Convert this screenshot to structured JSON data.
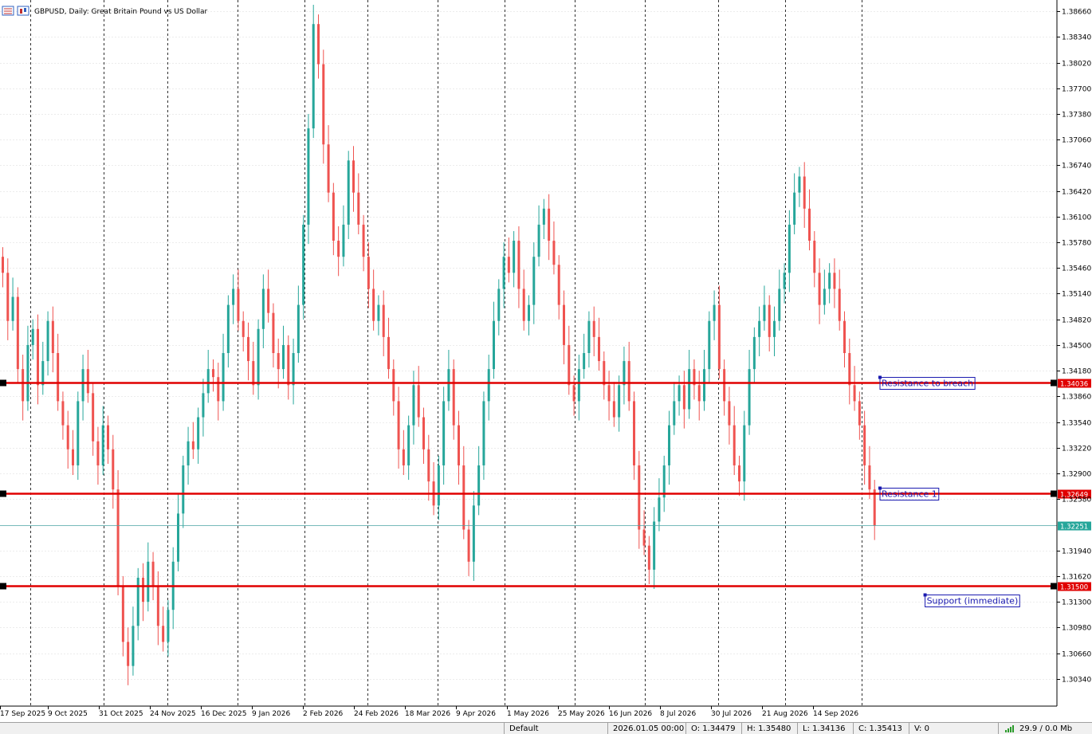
{
  "header": {
    "symbol_line": "GBPUSD, Daily:  Great Britain Pound vs US Dollar"
  },
  "colors": {
    "bull": "#26a69a",
    "bear": "#ef5350",
    "level_line": "#e00000",
    "label_text": "#1a1ab0",
    "price_line": "#4aa3a3"
  },
  "chart_data": {
    "type": "candlestick",
    "ylim": [
      1.3,
      1.388
    ],
    "y_ticks": [
      "1.38660",
      "1.38340",
      "1.38020",
      "1.37700",
      "1.37380",
      "1.37060",
      "1.36740",
      "1.36420",
      "1.36100",
      "1.35780",
      "1.35460",
      "1.35140",
      "1.34820",
      "1.34500",
      "1.34180",
      "1.33860",
      "1.33540",
      "1.33220",
      "1.32900",
      "1.32580",
      "1.31940",
      "1.31620",
      "1.31300",
      "1.30980",
      "1.30660",
      "1.30340"
    ],
    "x_ticks": [
      "17 Sep 2025",
      "9 Oct 2025",
      "31 Oct 2025",
      "24 Nov 2025",
      "16 Dec 2025",
      "9 Jan 2026",
      "2 Feb 2026",
      "24 Feb 2026",
      "18 Mar 2026",
      "9 Apr 2026",
      "1 May 2026",
      "25 May 2026",
      "16 Jun 2026",
      "8 Jul 2026",
      "30 Jul 2026",
      "21 Aug 2026",
      "14 Sep 2026"
    ],
    "closes": [
      1.354,
      1.348,
      1.351,
      1.342,
      1.338,
      1.345,
      1.347,
      1.34,
      1.343,
      1.348,
      1.344,
      1.338,
      1.335,
      1.332,
      1.33,
      1.338,
      1.342,
      1.339,
      1.333,
      1.33,
      1.335,
      1.332,
      1.327,
      1.315,
      1.308,
      1.305,
      1.31,
      1.316,
      1.313,
      1.318,
      1.315,
      1.31,
      1.308,
      1.312,
      1.318,
      1.324,
      1.33,
      1.333,
      1.332,
      1.336,
      1.339,
      1.342,
      1.341,
      1.338,
      1.344,
      1.35,
      1.352,
      1.348,
      1.346,
      1.343,
      1.34,
      1.347,
      1.352,
      1.349,
      1.344,
      1.342,
      1.345,
      1.34,
      1.344,
      1.35,
      1.36,
      1.372,
      1.385,
      1.38,
      1.37,
      1.364,
      1.358,
      1.356,
      1.36,
      1.368,
      1.364,
      1.36,
      1.356,
      1.352,
      1.348,
      1.35,
      1.346,
      1.342,
      1.338,
      1.332,
      1.33,
      1.335,
      1.34,
      1.336,
      1.332,
      1.328,
      1.325,
      1.33,
      1.338,
      1.342,
      1.335,
      1.33,
      1.322,
      1.318,
      1.325,
      1.33,
      1.338,
      1.342,
      1.348,
      1.352,
      1.356,
      1.354,
      1.358,
      1.352,
      1.348,
      1.35,
      1.356,
      1.36,
      1.362,
      1.358,
      1.355,
      1.35,
      1.345,
      1.34,
      1.338,
      1.342,
      1.344,
      1.348,
      1.346,
      1.343,
      1.34,
      1.338,
      1.336,
      1.34,
      1.343,
      1.338,
      1.33,
      1.322,
      1.32,
      1.317,
      1.323,
      1.326,
      1.33,
      1.335,
      1.338,
      1.34,
      1.337,
      1.342,
      1.34,
      1.338,
      1.342,
      1.348,
      1.35,
      1.342,
      1.338,
      1.335,
      1.33,
      1.328,
      1.335,
      1.342,
      1.346,
      1.348,
      1.35,
      1.346,
      1.348,
      1.352,
      1.354,
      1.36,
      1.364,
      1.366,
      1.362,
      1.358,
      1.354,
      1.35,
      1.352,
      1.354,
      1.352,
      1.348,
      1.344,
      1.34,
      1.338,
      1.335,
      1.33,
      1.327,
      1.3225
    ]
  },
  "levels": [
    {
      "name": "resistance-to-breach",
      "price": 1.34036,
      "tag": "1.34036",
      "label": "Resistance to breach",
      "label_index": 175
    },
    {
      "name": "resistance-1",
      "price": 1.32649,
      "tag": "1.32649",
      "label": "Resistance 1",
      "label_index": 175
    },
    {
      "name": "support-immediate",
      "price": 1.315,
      "tag": "1.31500",
      "label": "Support (immediate)",
      "label_index": 184
    }
  ],
  "current_price": {
    "price": 1.32251,
    "tag": "1.32251"
  },
  "statusbar": {
    "profile": "Default",
    "datetime": "2026.01.05 00:00",
    "open": "O: 1.34479",
    "high": "H: 1.35480",
    "low": "L: 1.34136",
    "close": "C: 1.35413",
    "volume": "V: 0",
    "traffic": "29.9 / 0.0 Mb"
  }
}
